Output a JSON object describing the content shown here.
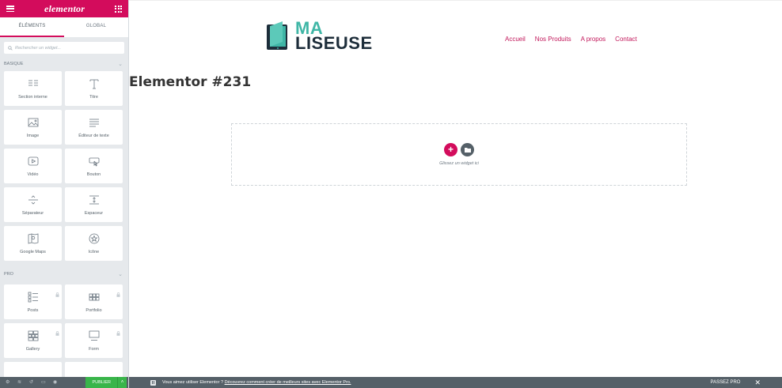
{
  "sidebar": {
    "logo": "elementor",
    "tabs": [
      "ÉLÉMENTS",
      "GLOBAL"
    ],
    "search_placeholder": "Rechercher un widget...",
    "sections": [
      {
        "title": "BASIQUE",
        "widgets": [
          {
            "label": "Section interne",
            "icon": "columns-icon"
          },
          {
            "label": "Titre",
            "icon": "heading-icon"
          },
          {
            "label": "Image",
            "icon": "image-icon"
          },
          {
            "label": "Éditeur de texte",
            "icon": "text-editor-icon"
          },
          {
            "label": "Vidéo",
            "icon": "video-icon"
          },
          {
            "label": "Bouton",
            "icon": "button-icon"
          },
          {
            "label": "Séparateur",
            "icon": "divider-icon"
          },
          {
            "label": "Espaceur",
            "icon": "spacer-icon"
          },
          {
            "label": "Google Maps",
            "icon": "map-icon"
          },
          {
            "label": "Icône",
            "icon": "star-icon"
          }
        ]
      },
      {
        "title": "PRO",
        "widgets": [
          {
            "label": "Posts",
            "icon": "posts-icon"
          },
          {
            "label": "Portfolio",
            "icon": "portfolio-icon"
          },
          {
            "label": "Gallery",
            "icon": "gallery-icon"
          },
          {
            "label": "Form",
            "icon": "form-icon"
          }
        ]
      }
    ],
    "footer": {
      "publish_label": "PUBLIER"
    }
  },
  "site": {
    "logo_line1": "MA",
    "logo_line2": "LISEUSE",
    "nav": [
      "Accueil",
      "Nos Produits",
      "A propos",
      "Contact"
    ],
    "page_title": "Elementor #231",
    "drop_hint": "Glissez un widget ici"
  },
  "notice": {
    "text": "Vous aimez utiliser Elementor ? ",
    "link": "Découvrez comment créer de meilleurs sites avec Elementor Pro.",
    "pro_label": "PASSEZ PRO",
    "close": "✕"
  },
  "colors": {
    "accent": "#d30c5c",
    "sidebar_bg": "#e6e9ec",
    "footer_bg": "#556068",
    "publish": "#39b54a",
    "logo_teal": "#3fb6a6",
    "logo_dark": "#1d2d3a",
    "nav_link": "#c2185b"
  }
}
